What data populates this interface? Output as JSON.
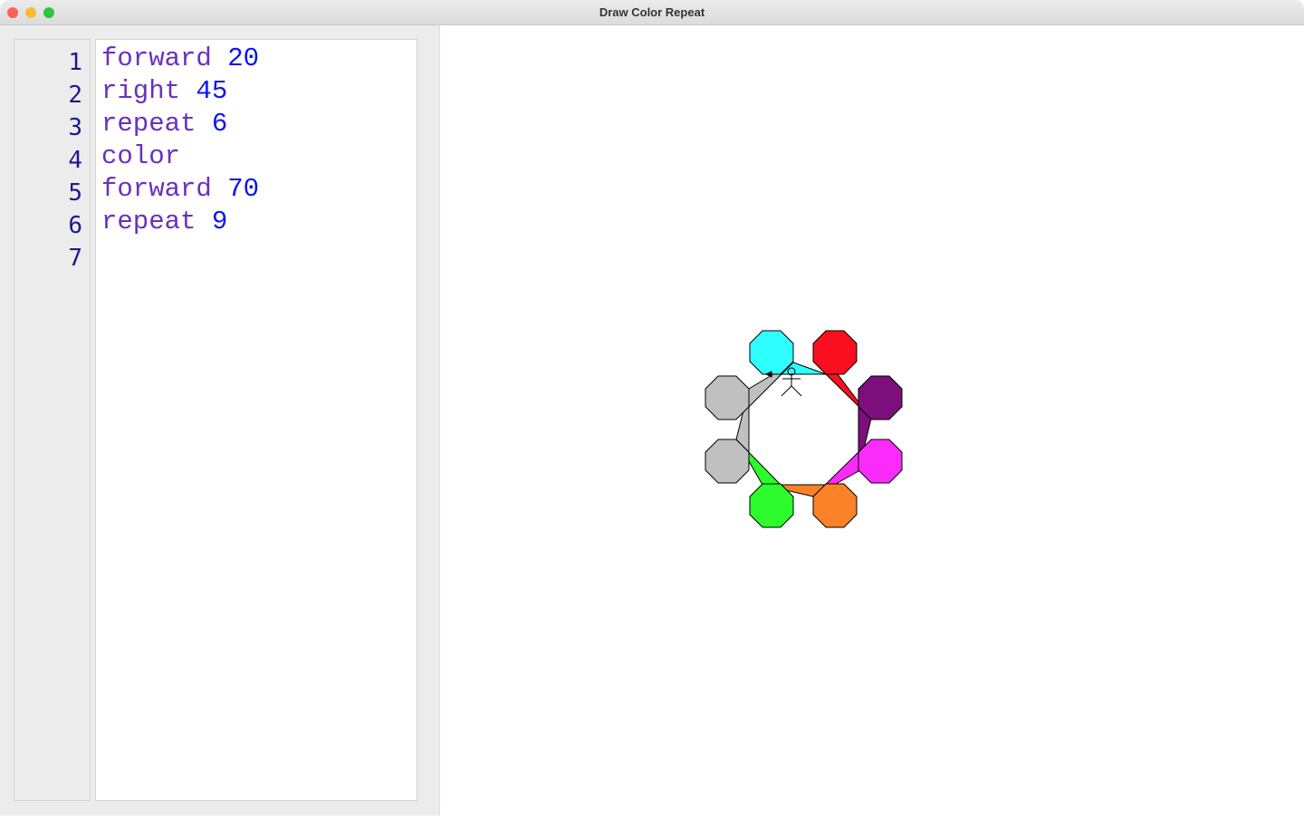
{
  "window": {
    "title": "Draw Color Repeat"
  },
  "editor": {
    "line_numbers": [
      "1",
      "2",
      "3",
      "4",
      "5",
      "6",
      "7"
    ],
    "lines": [
      {
        "keyword": "forward",
        "arg": "20"
      },
      {
        "keyword": "right",
        "arg": "45"
      },
      {
        "keyword": "repeat",
        "arg": "6"
      },
      {
        "keyword": "color",
        "arg": ""
      },
      {
        "keyword": "forward",
        "arg": "70"
      },
      {
        "keyword": "repeat",
        "arg": "9"
      },
      {
        "keyword": "",
        "arg": ""
      }
    ]
  },
  "colors": {
    "keyword": "#6a2fc2",
    "number": "#0a14f0",
    "octagons": [
      "#2ffefe",
      "#fb0f1f",
      "#7d0f7d",
      "#fb2cfb",
      "#fb8226",
      "#2cfb2c",
      "#c0c0c0",
      "#c0c0c0"
    ]
  }
}
